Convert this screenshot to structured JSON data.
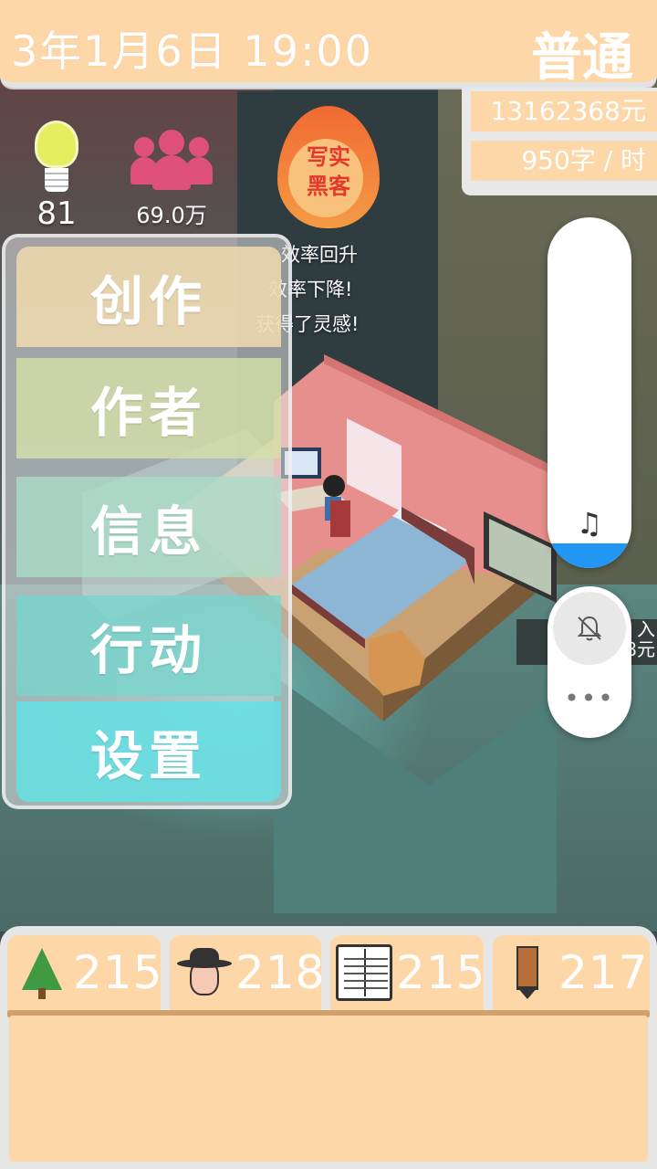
{
  "topbar": {
    "date_time": "3年1月6日  19:00",
    "difficulty": "普通"
  },
  "money": {
    "amount": "13162368元",
    "speed": "950字 / 时"
  },
  "stats": {
    "inspiration": "81",
    "fans": "69.0万"
  },
  "badge": {
    "line1": "写实",
    "line2": "黑客"
  },
  "messages": [
    "效率回升",
    "效率下降!",
    "获得了灵感!"
  ],
  "menu": {
    "items": [
      "创作",
      "作者",
      "信息",
      "行动",
      "设置"
    ]
  },
  "volume": {
    "level": 0.07,
    "music_icon": "music-note-icon",
    "mute_icon": "bell-off-icon",
    "more_label": "•••",
    "fill_color": "#2196f3"
  },
  "peek_text": {
    "line1": "入",
    "line2": "8元"
  },
  "bottom_stats": [
    {
      "icon": "tree-icon",
      "value": "215"
    },
    {
      "icon": "hat-person-icon",
      "value": "218"
    },
    {
      "icon": "book-icon",
      "value": "215"
    },
    {
      "icon": "pencil-icon",
      "value": "217"
    }
  ],
  "colors": {
    "panel": "#fdd7a8",
    "accent_blue": "#2196f3",
    "flame": "#f26a32",
    "fans": "#e0517a"
  }
}
